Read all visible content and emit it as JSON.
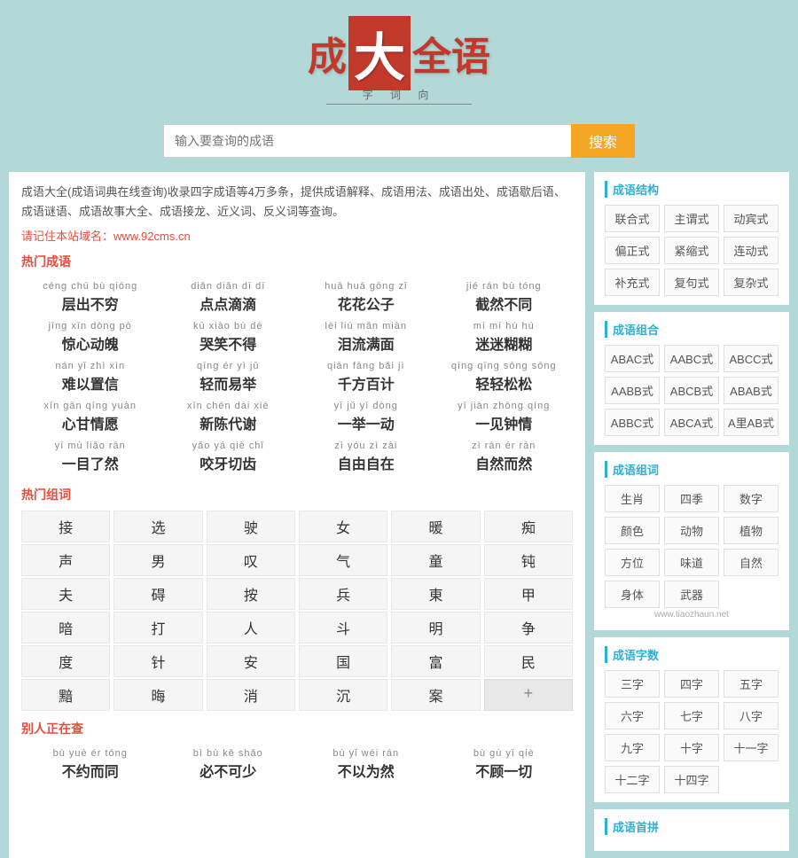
{
  "header": {
    "logo_char1": "成",
    "logo_big": "大",
    "logo_char2": "全",
    "logo_char3": "语",
    "subtitle": "字 词 向"
  },
  "search": {
    "placeholder": "输入要查询的成语",
    "button_label": "搜索"
  },
  "intro": {
    "text": "成语大全(成语词典在线查询)收录四字成语等4万多条，提供成语解释、成语用法、成语出处、成语歇后语、成语谜语、成语故事大全、成语接龙、近义词、反义词等查询。",
    "site_note": "请记住本站域名：www.92cms.cn"
  },
  "hot_idioms_title": "热门成语",
  "idioms": [
    {
      "pinyin": "céng chū bù qióng",
      "chinese": "层出不穷"
    },
    {
      "pinyin": "diǎn diǎn dī dī",
      "chinese": "点点滴滴"
    },
    {
      "pinyin": "huā huā gōng zǐ",
      "chinese": "花花公子"
    },
    {
      "pinyin": "jié rán bù tóng",
      "chinese": "截然不同"
    },
    {
      "pinyin": "jīng xīn dòng pò",
      "chinese": "惊心动魄"
    },
    {
      "pinyin": "kū xiào bù dé",
      "chinese": "哭笑不得"
    },
    {
      "pinyin": "lèi liú mǎn miàn",
      "chinese": "泪流满面"
    },
    {
      "pinyin": "mí mí hú hú",
      "chinese": "迷迷糊糊"
    },
    {
      "pinyin": "nán yǐ zhì xìn",
      "chinese": "难以置信"
    },
    {
      "pinyin": "qīng ér yì jǔ",
      "chinese": "轻而易举"
    },
    {
      "pinyin": "qiān fāng bǎi jì",
      "chinese": "千方百计"
    },
    {
      "pinyin": "qīng qīng sōng sōng",
      "chinese": "轻轻松松"
    },
    {
      "pinyin": "xīn gān qíng yuàn",
      "chinese": "心甘情愿"
    },
    {
      "pinyin": "xīn chén dài xiè",
      "chinese": "新陈代谢"
    },
    {
      "pinyin": "yī jǔ yī dòng",
      "chinese": "一举一动"
    },
    {
      "pinyin": "yī jiàn zhōng qíng",
      "chinese": "一见钟情"
    },
    {
      "pinyin": "yī mù liǎo rán",
      "chinese": "一目了然"
    },
    {
      "pinyin": "yǎo yá qiè chǐ",
      "chinese": "咬牙切齿"
    },
    {
      "pinyin": "zì yóu zì zài",
      "chinese": "自由自在"
    },
    {
      "pinyin": "zì rán ér rán",
      "chinese": "自然而然"
    }
  ],
  "hot_words_title": "热门组词",
  "hot_words": [
    [
      "接",
      "选",
      "驶",
      "女",
      "暖",
      "痴"
    ],
    [
      "声",
      "男",
      "叹",
      "气",
      "童",
      "钝"
    ],
    [
      "夫",
      "碍",
      "按",
      "兵",
      "東",
      "甲"
    ],
    [
      "暗",
      "打",
      "人",
      "斗",
      "明",
      "争"
    ],
    [
      "度",
      "针",
      "安",
      "国",
      "富",
      "民"
    ],
    [
      "黯",
      "晦",
      "消",
      "沉",
      "案",
      "+"
    ]
  ],
  "others_checking_title": "别人正在查",
  "others_idioms": [
    {
      "pinyin": "bù yuè ér tóng",
      "chinese": "不约而同"
    },
    {
      "pinyin": "bì bù kě shǎo",
      "chinese": "必不可少"
    },
    {
      "pinyin": "bù yǐ wéi rán",
      "chinese": "不以为然"
    },
    {
      "pinyin": "bù gù yī qiè",
      "chinese": "不顾一切"
    }
  ],
  "right_panel": {
    "structure_title": "成语结构",
    "structure_items": [
      "联合式",
      "主谓式",
      "动宾式",
      "偏正式",
      "紧缩式",
      "连动式",
      "补充式",
      "复句式",
      "复杂式"
    ],
    "combo_title": "成语组合",
    "combo_items": [
      "ABAC式",
      "AABC式",
      "ABCC式",
      "AABB式",
      "ABCB式",
      "ABAB式",
      "ABBC式",
      "ABCA式",
      "A里AB式"
    ],
    "groupword_title": "成语组词",
    "groupword_items": [
      "生肖",
      "四季",
      "数字",
      "颜色",
      "动物",
      "植物",
      "方位",
      "味道",
      "自然",
      "身体",
      "武器"
    ],
    "charcount_title": "成语字数",
    "charcount_items": [
      "三字",
      "四字",
      "五字",
      "六字",
      "七字",
      "八字",
      "九字",
      "十字",
      "十一字",
      "十二字",
      "十四字"
    ],
    "pinyin_title": "成语首拼",
    "watermark": "www.tiaozhaun.net"
  }
}
